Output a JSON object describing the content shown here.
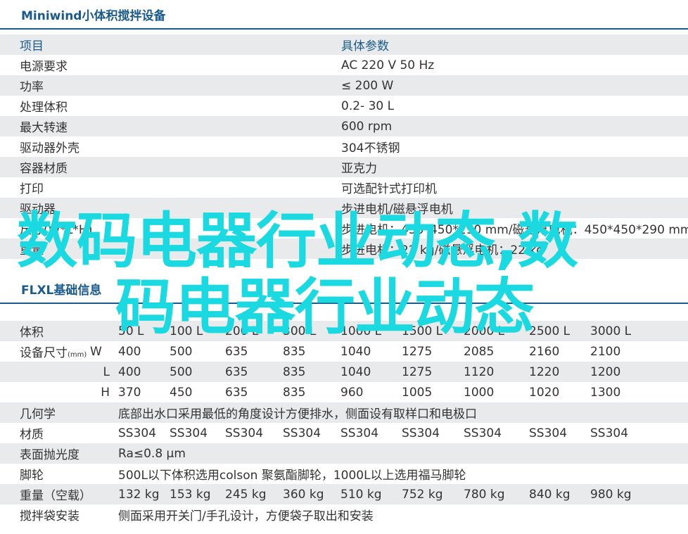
{
  "sections": {
    "miniwind_title": "Miniwind小体积搅拌设备",
    "flxl_title": "FLXL基础信息"
  },
  "spec_table": {
    "header": [
      "项目",
      "具体参数"
    ],
    "rows": [
      [
        "电源要求",
        "AC 220  V 50 Hz"
      ],
      [
        "功率",
        "≤ 200 W"
      ],
      [
        "处理体积",
        "0.2-  30 L"
      ],
      [
        "最大转速",
        "600  rpm"
      ],
      [
        "驱动器外壳",
        "304不锈钢"
      ],
      [
        "容器材质",
        "亚克力"
      ],
      [
        "打印",
        "可选配针式打印机"
      ],
      [
        "驱动器",
        "步进电机/磁悬浮电机"
      ],
      [
        "尺寸(W*L*H)",
        "步进电机：450*450*290 mm/磁悬浮电机：450*450*290 mm"
      ],
      [
        "重量",
        "步进电机：22 kg/磁悬浮电机：22 kg"
      ]
    ]
  },
  "flxl_table": {
    "volume": {
      "label": "体积",
      "values": [
        "50 L",
        "100 L",
        "200 L",
        "300 L",
        "1000 L",
        "1500 L",
        "2000 L",
        "2500 L",
        "3000 L"
      ]
    },
    "size_w": {
      "label": "设备尺寸",
      "unit": "(mm)",
      "sub": "W",
      "values": [
        "400",
        "500",
        "635",
        "835",
        "1040",
        "1275",
        "2085",
        "2160",
        "2100"
      ]
    },
    "size_l": {
      "sub": "L",
      "values": [
        "400",
        "500",
        "635",
        "835",
        "1040",
        "1275",
        "1120",
        "1220",
        "1200"
      ]
    },
    "size_h": {
      "sub": "H",
      "values": [
        "370",
        "450",
        "635",
        "835",
        "960",
        "1005",
        "1000",
        "1020",
        "1300"
      ]
    },
    "geometry": {
      "label": "几何学",
      "text": "底部出水口采用最低的角度设计方便排水，侧面设有取样口和电极口"
    },
    "material": {
      "label": "材质",
      "values": [
        "SS304",
        "SS304",
        "SS304",
        "SS304",
        "SS304",
        "SS304",
        "SS304",
        "SS304",
        "SS304"
      ]
    },
    "polish": {
      "label": "表面抛光度",
      "text": "Ra≤0.8 μm"
    },
    "casters": {
      "label": "脚轮",
      "text": "500L以下体积选用colson 聚氨酯脚轮，1000L以上选用福马脚轮"
    },
    "weight": {
      "label": "重量（空载）",
      "values": [
        "132 kg",
        "153 kg",
        "245 kg",
        "360 kg",
        "510 kg",
        "752 kg",
        "780 kg",
        "840 kg",
        "980 kg"
      ]
    },
    "bag": {
      "label": "搅拌袋安装",
      "text": "侧面采用开关门/手孔设计，方便袋子取出和安装"
    }
  },
  "overlay": {
    "line1": "数码电器行业动态,数",
    "line2": "码电器行业动态"
  },
  "colors": {
    "accent": "#1a5b8c",
    "shade": "#e9eaec",
    "overlay": "#1ad9e0"
  }
}
